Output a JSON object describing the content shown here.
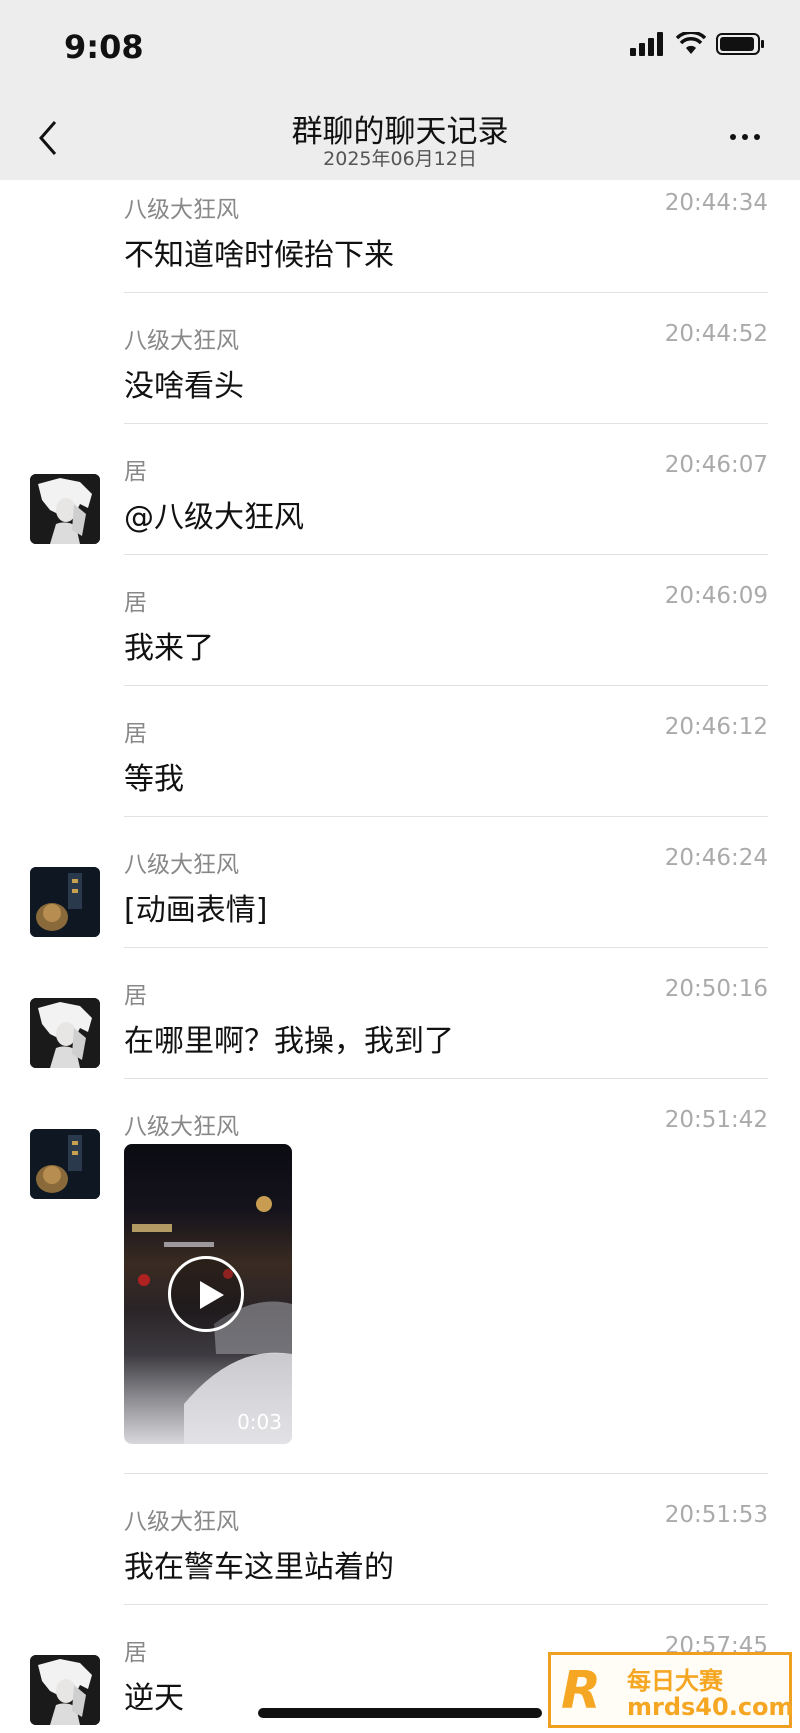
{
  "status_bar": {
    "time": "9:08"
  },
  "nav": {
    "title": "群聊的聊天记录",
    "subtitle": "2025年06月12日"
  },
  "messages": [
    {
      "sender": "八级大狂风",
      "time": "20:44:34",
      "text": "不知道啥时候抬下来",
      "avatar": "none"
    },
    {
      "sender": "八级大狂风",
      "time": "20:44:52",
      "text": "没啥看头",
      "avatar": "none"
    },
    {
      "sender": "居",
      "time": "20:46:07",
      "text": "@八级大狂风",
      "avatar": "ju"
    },
    {
      "sender": "居",
      "time": "20:46:09",
      "text": "我来了",
      "avatar": "none"
    },
    {
      "sender": "居",
      "time": "20:46:12",
      "text": "等我",
      "avatar": "none"
    },
    {
      "sender": "八级大狂风",
      "time": "20:46:24",
      "text": "[动画表情]",
      "avatar": "ba"
    },
    {
      "sender": "居",
      "time": "20:50:16",
      "text": "在哪里啊？我操，我到了",
      "avatar": "ju"
    },
    {
      "sender": "八级大狂风",
      "time": "20:51:42",
      "text": "",
      "avatar": "ba"
    },
    {
      "sender": "八级大狂风",
      "time": "20:51:53",
      "text": "我在警车这里站着的",
      "avatar": "none"
    },
    {
      "sender": "居",
      "time": "20:57:45",
      "text": "逆天",
      "avatar": "ju"
    }
  ],
  "video": {
    "duration": "0:03"
  },
  "watermark": {
    "line1": "每日大赛",
    "line2": "mrds40.com",
    "logo_letter": "R"
  },
  "colors": {
    "nav_bg": "#ededed",
    "text": "#111111",
    "meta": "#888888",
    "watermark": "#f5a623"
  }
}
